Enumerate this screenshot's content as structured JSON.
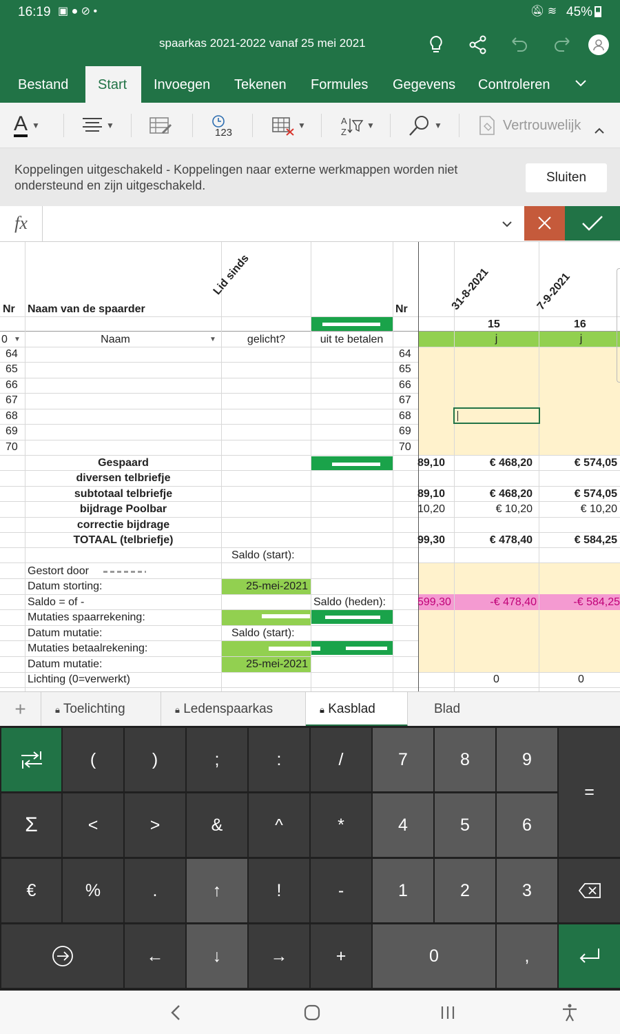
{
  "status": {
    "time": "16:19",
    "battery": "45%"
  },
  "doc": {
    "title": "spaarkas 2021-2022 vanaf 25 mei 2021"
  },
  "tabs": [
    "Bestand",
    "Start",
    "Invoegen",
    "Tekenen",
    "Formules",
    "Gegevens",
    "Controleren"
  ],
  "toolbar": {
    "confidential": "Vertrouwelijk"
  },
  "notice": {
    "line1": "Koppelingen uitgeschakeld - Koppelingen naar externe werkmappen worden niet",
    "line2": "ondersteund en zijn uitgeschakeld.",
    "close": "Sluiten"
  },
  "formula": {
    "fx": "fx",
    "value": ""
  },
  "sheet": {
    "header": {
      "nr": "Nr",
      "naam": "Naam van de spaarder",
      "lid": "Lid sinds",
      "nr2": "Nr",
      "date1": "31-8-2021",
      "date2": "7-9-2021",
      "n1": "15",
      "n2": "16"
    },
    "row2": {
      "filter0": "0",
      "naam": "Naam",
      "gelicht": "gelicht?",
      "uit": "uit te betalen",
      "j1": "j",
      "j2": "j"
    },
    "rows": [
      "64",
      "65",
      "66",
      "67",
      "68",
      "69",
      "70"
    ],
    "summary": [
      {
        "label": "Gespaard",
        "c1": "89,10",
        "c2": "€ 468,20",
        "c3": "€ 574,05"
      },
      {
        "label": "diversen telbriefje",
        "c1": "",
        "c2": "",
        "c3": ""
      },
      {
        "label": "subtotaal telbriefje",
        "c1": "89,10",
        "c2": "€ 468,20",
        "c3": "€ 574,05"
      },
      {
        "label": "bijdrage Poolbar",
        "c1": "10,20",
        "c2": "€ 10,20",
        "c3": "€ 10,20"
      },
      {
        "label": "correctie bijdrage",
        "c1": "",
        "c2": "",
        "c3": ""
      },
      {
        "label": "TOTAAL (telbriefje)",
        "c1": "99,30",
        "c2": "€ 478,40",
        "c3": "€ 584,25"
      }
    ],
    "lower": {
      "saldo_start": "Saldo (start):",
      "gestort": "Gestort door",
      "datum_storting": "Datum storting:",
      "datum_storting_val": "25-mei-2021",
      "saldo_of": "Saldo = of -",
      "saldo_heden": "Saldo (heden):",
      "neg1": "599,30",
      "neg2": "-€ 478,40",
      "neg3": "-€ 584,25",
      "mut_spaar": "Mutaties spaarrekening:",
      "datum_mutatie": "Datum mutatie:",
      "saldo_start2": "Saldo (start):",
      "mut_betaal": "Mutaties betaalrekening:",
      "datum_mutatie2": "Datum mutatie:",
      "datum_mutatie2_val": "25-mei-2021",
      "lichting": "Lichting (0=verwerkt)",
      "l1": "0",
      "l2": "0"
    }
  },
  "sheettabs": [
    "Toelichting",
    "Ledenspaarkas",
    "Kasblad",
    "Blad"
  ],
  "keyboard": {
    "row1": [
      "(",
      ")",
      ";",
      ":",
      "/",
      "7",
      "8",
      "9"
    ],
    "row2": [
      "<",
      ">",
      "&",
      "^",
      "*",
      "4",
      "5",
      "6"
    ],
    "row3": [
      "€",
      "%",
      ".",
      "↑",
      "!",
      "-",
      "1",
      "2",
      "3"
    ],
    "row4": [
      "←",
      "↓",
      "→",
      "+",
      "0",
      ","
    ],
    "equals": "=",
    "sigma": "Σ"
  },
  "colors": {
    "brand": "#217346",
    "cream": "#fff2cc",
    "lightgreen": "#92d050",
    "pink": "#f49ad1",
    "cancel": "#c55a3b"
  }
}
